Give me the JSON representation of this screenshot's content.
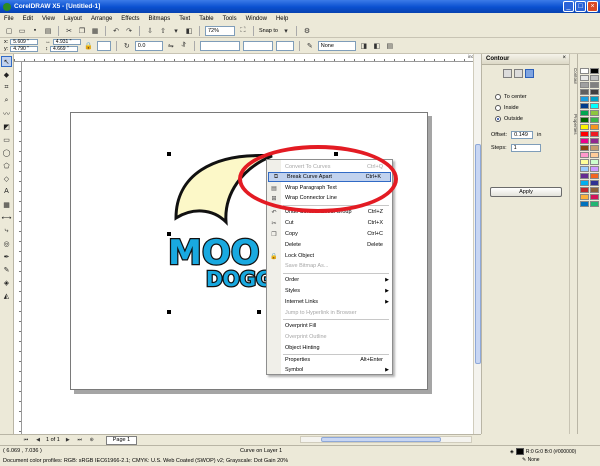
{
  "window": {
    "title": "CorelDRAW X5 - [Untitled-1]",
    "controls": [
      "_",
      "□",
      "×"
    ]
  },
  "menu": [
    "File",
    "Edit",
    "View",
    "Layout",
    "Arrange",
    "Effects",
    "Bitmaps",
    "Text",
    "Table",
    "Tools",
    "Window",
    "Help"
  ],
  "toolbar": {
    "zoom": "72%",
    "snap_to": "Snap to"
  },
  "property_bar": {
    "x": "5.609 \"",
    "y": "4.790 \"",
    "w": "4.931 \"",
    "h": "4.669 \"",
    "rotation": "0.0",
    "outline": "None"
  },
  "ruler": {
    "unit": "inches"
  },
  "logo": {
    "line1": "MOO",
    "line2": "DOGG",
    "colors": {
      "blue": "#19a9e0",
      "moon": "#fcf8c8",
      "outline": "#111111"
    }
  },
  "context_menu": {
    "items": [
      {
        "label": "Convert To Curves",
        "shortcut": "Ctrl+Q",
        "disabled": true
      },
      {
        "label": "Break Curve Apart",
        "shortcut": "Ctrl+K",
        "highlighted": true
      },
      {
        "label": "Wrap Paragraph Text",
        "shortcut": ""
      },
      {
        "label": "Wrap Connector Line",
        "shortcut": ""
      },
      {
        "label": "Undo Contour Effect Group",
        "shortcut": "Ctrl+Z"
      },
      {
        "label": "Cut",
        "shortcut": "Ctrl+X"
      },
      {
        "label": "Copy",
        "shortcut": "Ctrl+C"
      },
      {
        "label": "Delete",
        "shortcut": "Delete"
      },
      {
        "label": "Lock Object",
        "shortcut": ""
      },
      {
        "label": "Save Bitmap As...",
        "shortcut": "",
        "disabled": true
      },
      {
        "label": "Order",
        "shortcut": "",
        "submenu": true
      },
      {
        "label": "Styles",
        "shortcut": "",
        "submenu": true
      },
      {
        "label": "Internet Links",
        "shortcut": "",
        "submenu": true
      },
      {
        "label": "Jump to Hyperlink in Browser",
        "shortcut": "",
        "disabled": true
      },
      {
        "label": "Overprint Fill",
        "shortcut": ""
      },
      {
        "label": "Overprint Outline",
        "shortcut": "",
        "disabled": true
      },
      {
        "label": "Object Hinting",
        "shortcut": ""
      },
      {
        "label": "Properties",
        "shortcut": "Alt+Enter"
      },
      {
        "label": "Symbol",
        "shortcut": "",
        "submenu": true
      }
    ]
  },
  "contour_docker": {
    "title": "Contour",
    "options": [
      "To center",
      "Inside",
      "Outside"
    ],
    "selected_option": "Outside",
    "offset_label": "Offset:",
    "offset_value": "0.149",
    "offset_unit": "in",
    "steps_label": "Steps:",
    "steps_value": "1",
    "apply_label": "Apply"
  },
  "docker_tabs": [
    "Contour",
    "Properties"
  ],
  "palette": [
    "#ffffff",
    "#000000",
    "#e8e8e8",
    "#c0c0c0",
    "#a0a0a0",
    "#808080",
    "#606060",
    "#404040",
    "#1a9fe0",
    "#00a0c6",
    "#003c8c",
    "#00ffff",
    "#00a651",
    "#8dc63f",
    "#006400",
    "#39b54a",
    "#fff200",
    "#f7941d",
    "#ff0000",
    "#ed1c24",
    "#ec008c",
    "#92278f",
    "#8b4513",
    "#c69c6d",
    "#ff99cc",
    "#ffcc99",
    "#ffff99",
    "#ccffcc",
    "#99ccff",
    "#cc99ff",
    "#662d91",
    "#f26522",
    "#00aeef",
    "#2e3192",
    "#c1272d",
    "#8c6239",
    "#fbb03b",
    "#d4145a",
    "#0071bc",
    "#22b573"
  ],
  "navigation": {
    "page_count": "1 of 1",
    "page_tab": "Page 1"
  },
  "status": {
    "coords": "( 6.069 , 7.036 )",
    "object": "Curve on Layer 1",
    "profile": "Document color profiles: RGB: sRGB IEC61966-2.1; CMYK: U.S. Web Coated (SWOP) v2; Grayscale: Dot Gain 20%",
    "fill": "R:0 G:0 B:0 (#000000)",
    "outline": "None"
  }
}
